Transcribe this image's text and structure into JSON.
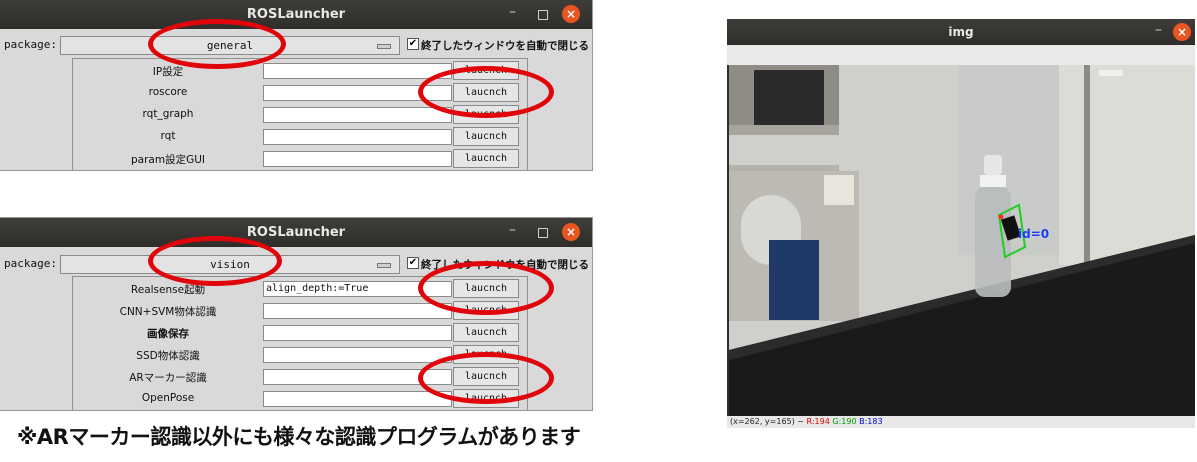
{
  "window1": {
    "title": "ROSLauncher",
    "package_label": "package:",
    "package_value": "general",
    "checkbox_mark": "✔",
    "checkbox_label": "終了したウィンドウを自動で閉じる",
    "rows": [
      {
        "label": "IP設定",
        "arg": "",
        "button": "laucnch"
      },
      {
        "label": "roscore",
        "arg": "",
        "button": "laucnch"
      },
      {
        "label": "rqt_graph",
        "arg": "",
        "button": "laucnch"
      },
      {
        "label": "rqt",
        "arg": "",
        "button": "laucnch"
      },
      {
        "label": "param設定GUI",
        "arg": "",
        "button": "laucnch"
      }
    ]
  },
  "window2": {
    "title": "ROSLauncher",
    "package_label": "package:",
    "package_value": "vision",
    "checkbox_mark": "✔",
    "checkbox_label": "終了したウィンドウを自動で閉じる",
    "rows": [
      {
        "label": "Realsense起動",
        "arg": "align_depth:=True",
        "button": "laucnch"
      },
      {
        "label": "CNN+SVM物体認識",
        "arg": "",
        "button": "laucnch"
      },
      {
        "label": "画像保存",
        "arg": "",
        "button": "laucnch"
      },
      {
        "label": "SSD物体認識",
        "arg": "",
        "button": "laucnch"
      },
      {
        "label": "ARマーカー認識",
        "arg": "",
        "button": "laucnch"
      },
      {
        "label": "OpenPose",
        "arg": "",
        "button": "laucnch"
      }
    ]
  },
  "note": "※ARマーカー認識以外にも様々な認識プログラムがあります",
  "img_window": {
    "title": "img",
    "marker_label": "id=0",
    "status_prefix": "(x=262, y=165) ~",
    "status_r": "R:194",
    "status_g": "G:190",
    "status_b": "B:183"
  },
  "window_controls": {
    "minimize": "–",
    "close": "×"
  },
  "colors": {
    "highlight_ring": "#e0050a",
    "titlebar": "#2f2e2b",
    "close_button": "#e95420",
    "marker_box": "#22cc22",
    "marker_text": "#1a3cff"
  }
}
